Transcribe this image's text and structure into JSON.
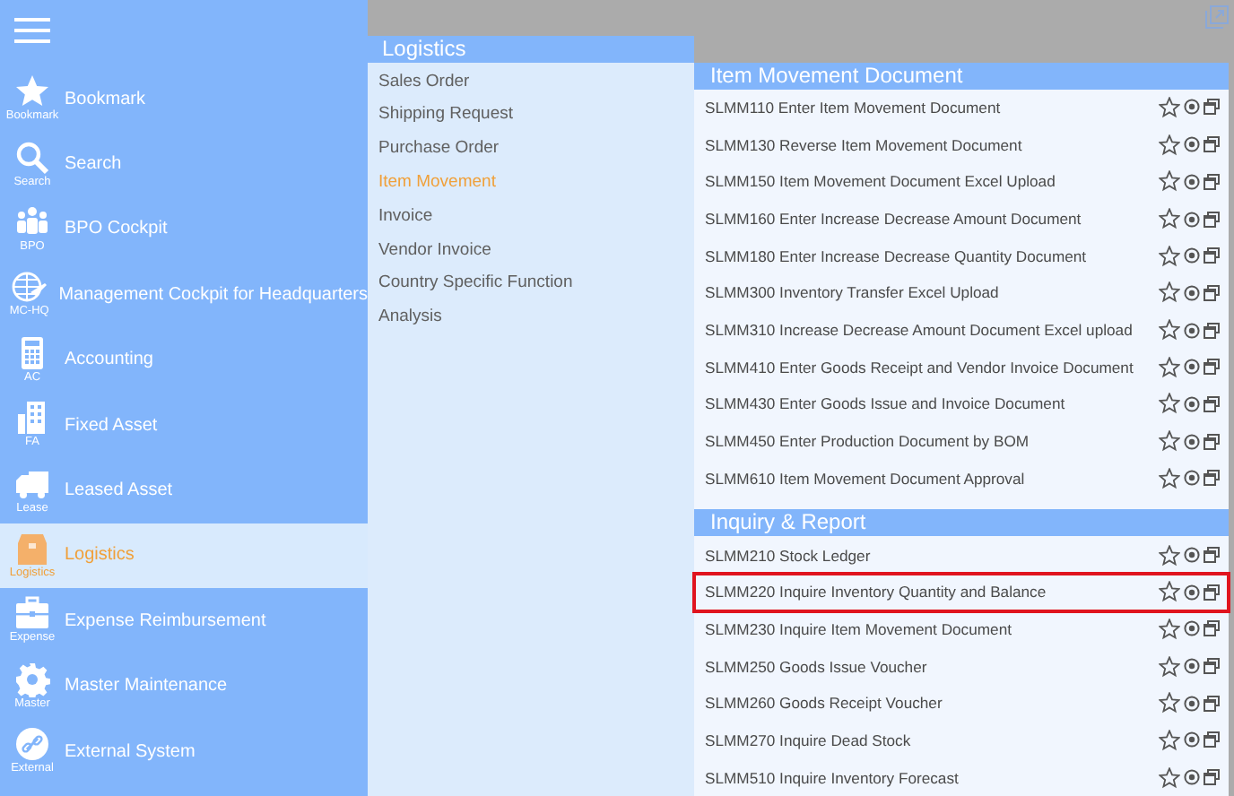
{
  "sidebar": {
    "items": [
      {
        "label": "Bookmark",
        "caption": "Bookmark",
        "selected": false
      },
      {
        "label": "Search",
        "caption": "Search",
        "selected": false
      },
      {
        "label": "BPO Cockpit",
        "caption": "BPO",
        "selected": false
      },
      {
        "label": "Management Cockpit for Headquarters",
        "caption": "MC-HQ",
        "selected": false
      },
      {
        "label": "Accounting",
        "caption": "AC",
        "selected": false
      },
      {
        "label": "Fixed Asset",
        "caption": "FA",
        "selected": false
      },
      {
        "label": "Leased Asset",
        "caption": "Lease",
        "selected": false
      },
      {
        "label": "Logistics",
        "caption": "Logistics",
        "selected": true
      },
      {
        "label": "Expense Reimbursement",
        "caption": "Expense",
        "selected": false
      },
      {
        "label": "Master Maintenance",
        "caption": "Master",
        "selected": false
      },
      {
        "label": "External System",
        "caption": "External",
        "selected": false
      }
    ]
  },
  "category_panel": {
    "title": "Logistics",
    "items": [
      {
        "label": "Sales Order",
        "selected": false
      },
      {
        "label": "Shipping Request",
        "selected": false
      },
      {
        "label": "Purchase Order",
        "selected": false
      },
      {
        "label": "Item Movement",
        "selected": true
      },
      {
        "label": "Invoice",
        "selected": false
      },
      {
        "label": "Vendor Invoice",
        "selected": false
      },
      {
        "label": "Country Specific Function",
        "selected": false
      },
      {
        "label": "Analysis",
        "selected": false
      }
    ]
  },
  "function_panel": {
    "sections": [
      {
        "title": "Item Movement Document",
        "items": [
          {
            "label": "SLMM110 Enter Item Movement Document",
            "highlighted": false
          },
          {
            "label": "SLMM130 Reverse Item Movement Document",
            "highlighted": false
          },
          {
            "label": "SLMM150 Item Movement Document Excel Upload",
            "highlighted": false
          },
          {
            "label": "SLMM160 Enter Increase Decrease Amount Document",
            "highlighted": false
          },
          {
            "label": "SLMM180 Enter Increase Decrease Quantity Document",
            "highlighted": false
          },
          {
            "label": "SLMM300 Inventory Transfer Excel Upload",
            "highlighted": false
          },
          {
            "label": "SLMM310 Increase Decrease Amount Document Excel upload",
            "highlighted": false
          },
          {
            "label": "SLMM410 Enter Goods Receipt and Vendor Invoice Document",
            "highlighted": false
          },
          {
            "label": "SLMM430 Enter Goods Issue and Invoice Document",
            "highlighted": false
          },
          {
            "label": "SLMM450 Enter Production Document by BOM",
            "highlighted": false
          },
          {
            "label": "SLMM610 Item Movement Document Approval",
            "highlighted": false
          }
        ]
      },
      {
        "title": "Inquiry & Report",
        "items": [
          {
            "label": "SLMM210 Stock Ledger",
            "highlighted": false
          },
          {
            "label": "SLMM220 Inquire Inventory Quantity and Balance",
            "highlighted": true
          },
          {
            "label": "SLMM230 Inquire Item Movement Document",
            "highlighted": false
          },
          {
            "label": "SLMM250 Goods Issue Voucher",
            "highlighted": false
          },
          {
            "label": "SLMM260 Goods Receipt Voucher",
            "highlighted": false
          },
          {
            "label": "SLMM270 Inquire Dead Stock",
            "highlighted": false
          },
          {
            "label": "SLMM510 Inquire Inventory Forecast",
            "highlighted": false
          }
        ]
      }
    ]
  }
}
